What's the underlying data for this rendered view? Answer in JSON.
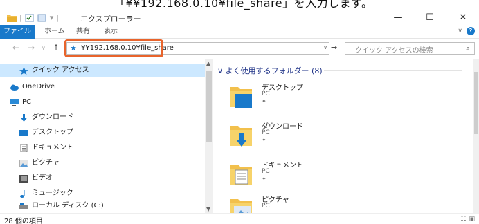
{
  "caption": {
    "text": "「¥¥192.168.0.10¥file_share」を入力します。"
  },
  "window": {
    "title": "エクスプローラー",
    "controls": {
      "minimize": "—",
      "maximize": "☐",
      "close": "✕"
    }
  },
  "ribbon": {
    "tabs": [
      "ファイル",
      "ホーム",
      "共有",
      "表示"
    ],
    "expand": "∨",
    "help": "?"
  },
  "navbar": {
    "back": "←",
    "forward": "→",
    "recent": "∨",
    "up": "↑",
    "address_value": "¥¥192.168.0.10¥file_share",
    "address_dropdown": "∨",
    "go": "→",
    "search_placeholder": "クイック アクセスの検索",
    "search_icon": "⌕"
  },
  "sidebar": {
    "items": [
      {
        "label": "クイック アクセス",
        "icon": "star-icon",
        "selected": true
      },
      {
        "label": "OneDrive",
        "icon": "cloud-icon"
      },
      {
        "label": "PC",
        "icon": "computer-icon"
      },
      {
        "label": "ダウンロード",
        "icon": "download-arrow-icon"
      },
      {
        "label": "デスクトップ",
        "icon": "desktop-icon"
      },
      {
        "label": "ドキュメント",
        "icon": "document-icon"
      },
      {
        "label": "ピクチャ",
        "icon": "picture-icon"
      },
      {
        "label": "ビデオ",
        "icon": "video-icon"
      },
      {
        "label": "ミュージック",
        "icon": "music-icon"
      },
      {
        "label": "ローカル ディスク (C:)",
        "icon": "disk-icon"
      }
    ]
  },
  "content": {
    "group_header": "よく使用するフォルダー (8)",
    "folders": [
      {
        "name": "デスクトップ",
        "location": "PC",
        "pin": "📌"
      },
      {
        "name": "ダウンロード",
        "location": "PC",
        "pin": "📌"
      },
      {
        "name": "ドキュメント",
        "location": "PC",
        "pin": "📌"
      },
      {
        "name": "ピクチャ",
        "location": "PC",
        "pin": ""
      }
    ]
  },
  "statusbar": {
    "item_count": "28 個の項目"
  },
  "colors": {
    "accent": "#1979ca",
    "selection": "#cce8ff",
    "highlight_border": "#e8642c",
    "folder": "#f2c04c"
  }
}
